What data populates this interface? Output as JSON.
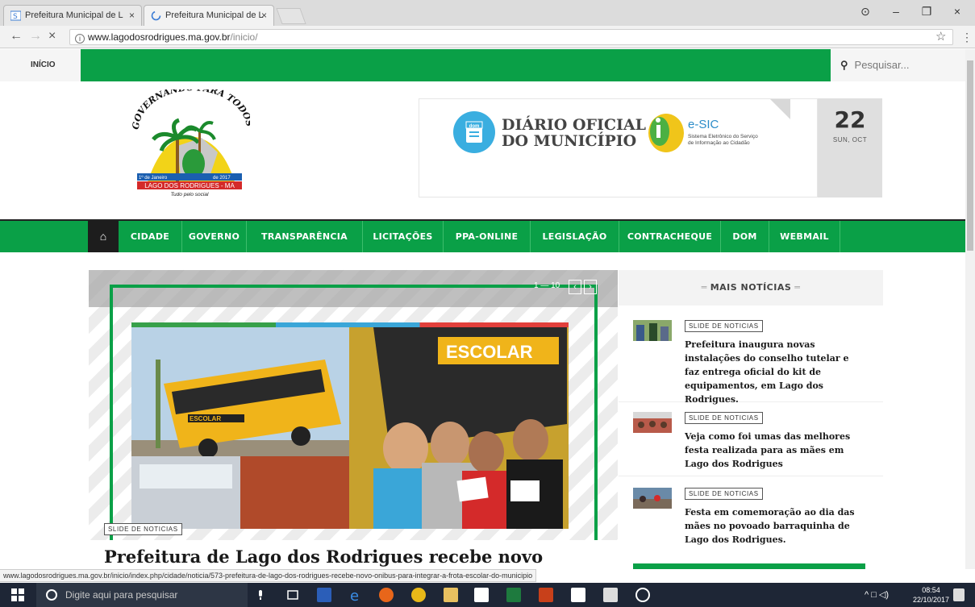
{
  "browser": {
    "tabs": [
      {
        "title": "Prefeitura Municipal de L",
        "close": "×"
      },
      {
        "title": "Prefeitura Municipal de L",
        "close": "×"
      }
    ],
    "window_controls": {
      "account": "⊙",
      "minimize": "–",
      "maximize": "❐",
      "close": "×"
    },
    "nav": {
      "back": "←",
      "forward": "→",
      "stop": "×"
    },
    "url_domain": "www.lagodosrodrigues.ma.gov.br",
    "url_path": "/inicio/",
    "url_info": "i",
    "star": "☆",
    "menu": "⋮"
  },
  "topbar": {
    "inicio": "INÍCIO",
    "search_icon": "search-icon",
    "search_placeholder": "Pesquisar..."
  },
  "logo": {
    "arc_text": "GOVERNANDO PARA TODOS",
    "date_left": "1º de Janeiro",
    "date_right": "de 2017",
    "city": "LAGO DOS RODRIGUES - MA",
    "slogan": "Tudo pelo social"
  },
  "banner": {
    "dom_badge": "dom",
    "dom_line1": "DIÁRIO OFICIAL",
    "dom_line2": "DO MUNICÍPIO",
    "esic_title": "e-SIC",
    "esic_sub1": "Sistema Eletrônico do Serviço",
    "esic_sub2": "de Informação ao Cidadão",
    "date_day": "22",
    "date_text": "SUN, OCT"
  },
  "nav": {
    "home_icon": "home-icon",
    "items": [
      "CIDADE",
      "GOVERNO",
      "TRANSPARÊNCIA",
      "LICITAÇÕES",
      "PPA-ONLINE",
      "LEGISLAÇÃO",
      "CONTRACHEQUE",
      "DOM",
      "WEBMAIL"
    ]
  },
  "slider": {
    "counter": "1 — 10",
    "prev": "‹",
    "next": "›",
    "photo_sign": "ESCOLAR",
    "bus_side": "ESCOLAR",
    "category": "SLIDE DE NOTICIAS",
    "title": "Prefeitura de Lago dos Rodrigues recebe novo"
  },
  "sidebar": {
    "header": "MAIS NOTÍCIAS",
    "dash": "═",
    "items": [
      {
        "category": "SLIDE DE NOTICIAS",
        "title": "Prefeitura inaugura novas instalações do conselho tutelar e faz entrega oficial do kit de equipamentos, em Lago dos Rodrigues."
      },
      {
        "category": "SLIDE DE NOTICIAS",
        "title": "Veja como foi umas das melhores festa realizada para as mães em Lago dos Rodrigues"
      },
      {
        "category": "SLIDE DE NOTICIAS",
        "title": "Festa em comemoração ao dia das mães no povoado barraquinha de Lago dos Rodrigues."
      }
    ]
  },
  "status_url": "www.lagodosrodrigues.ma.gov.br/inicio/index.php/cidade/noticia/573-prefeitura-de-lago-dos-rodrigues-recebe-novo-onibus-para-integrar-a-frota-escolar-do-municipio",
  "taskbar": {
    "search_placeholder": "Digite aqui para pesquisar",
    "tray_icons": "^ □ ◁)",
    "time": "08:54",
    "date": "22/10/2017"
  },
  "colors": {
    "green": "#0aa047",
    "dark": "#1d1d1d",
    "taskbar": "#1e2636"
  }
}
